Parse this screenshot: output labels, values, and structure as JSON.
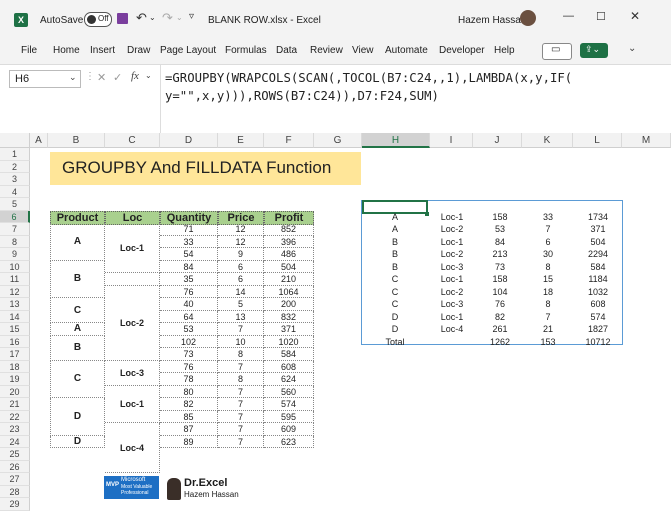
{
  "titlebar": {
    "autosave_label": "AutoSave",
    "autosave_state": "Off",
    "filename": "BLANK ROW.xlsx - Excel",
    "user_name": "Hazem Hassan"
  },
  "menu": [
    "File",
    "Home",
    "Insert",
    "Draw",
    "Page Layout",
    "Formulas",
    "Data",
    "Review",
    "View",
    "Automate",
    "Developer",
    "Help"
  ],
  "namebox": "H6",
  "formula_line1": "=GROUPBY(WRAPCOLS(SCAN(,TOCOL(B7:C24,,1),LAMBDA(x,y,IF(",
  "formula_line2": "y=\"\",x,y))),ROWS(B7:C24)),D7:F24,SUM)",
  "columns": [
    "A",
    "B",
    "C",
    "D",
    "E",
    "F",
    "G",
    "H",
    "I",
    "J",
    "K",
    "L",
    "M"
  ],
  "rows": [
    "1",
    "2",
    "3",
    "4",
    "5",
    "6",
    "7",
    "8",
    "9",
    "10",
    "11",
    "12",
    "13",
    "14",
    "15",
    "16",
    "17",
    "18",
    "19",
    "20",
    "21",
    "22",
    "23",
    "24",
    "25",
    "26",
    "27",
    "28",
    "29"
  ],
  "banner_title": "GROUPBY And FILLDATA Function",
  "table_headers": [
    "Product",
    "Loc",
    "Quantity",
    "Price",
    "Profit"
  ],
  "products": [
    {
      "label": "A",
      "span": 3
    },
    {
      "label": "B",
      "span": 3
    },
    {
      "label": "C",
      "span": 2
    },
    {
      "label": "A",
      "span": 1
    },
    {
      "label": "B",
      "span": 2
    },
    {
      "label": "C",
      "span": 3
    },
    {
      "label": "D",
      "span": 3
    },
    {
      "label": "D",
      "span": 1
    }
  ],
  "locs": [
    {
      "label": "Loc-1",
      "span": 4
    },
    {
      "label": "",
      "span": 1
    },
    {
      "label": "Loc-2",
      "span": 6
    },
    {
      "label": "Loc-3",
      "span": 2
    },
    {
      "label": "Loc-1",
      "span": 3
    },
    {
      "label": "Loc-4",
      "span": 4
    }
  ],
  "quantities": [
    "71",
    "33",
    "54",
    "84",
    "35",
    "76",
    "40",
    "64",
    "53",
    "102",
    "73",
    "76",
    "78",
    "80",
    "82",
    "85",
    "87",
    "89"
  ],
  "prices": [
    "12",
    "12",
    "9",
    "6",
    "6",
    "14",
    "5",
    "13",
    "7",
    "10",
    "8",
    "7",
    "8",
    "7",
    "7",
    "7",
    "7",
    "7"
  ],
  "profits": [
    "852",
    "396",
    "486",
    "504",
    "210",
    "1064",
    "200",
    "832",
    "371",
    "1020",
    "584",
    "608",
    "624",
    "560",
    "574",
    "595",
    "609",
    "623"
  ],
  "result": [
    [
      "A",
      "Loc-1",
      "158",
      "33",
      "1734"
    ],
    [
      "A",
      "Loc-2",
      "53",
      "7",
      "371"
    ],
    [
      "B",
      "Loc-1",
      "84",
      "6",
      "504"
    ],
    [
      "B",
      "Loc-2",
      "213",
      "30",
      "2294"
    ],
    [
      "B",
      "Loc-3",
      "73",
      "8",
      "584"
    ],
    [
      "C",
      "Loc-1",
      "158",
      "15",
      "1184"
    ],
    [
      "C",
      "Loc-2",
      "104",
      "18",
      "1032"
    ],
    [
      "C",
      "Loc-3",
      "76",
      "8",
      "608"
    ],
    [
      "D",
      "Loc-1",
      "82",
      "7",
      "574"
    ],
    [
      "D",
      "Loc-4",
      "261",
      "21",
      "1827"
    ],
    [
      "Total",
      "",
      "1262",
      "153",
      "10712"
    ]
  ],
  "logo": {
    "mvp_line1": "Microsoft",
    "mvp_line2": "Most Valuable",
    "mvp_line3": "Professional",
    "mvp_badge": "MVP",
    "brand": "Dr.Excel",
    "brand_sub": "Hazem Hassan"
  },
  "colors": {
    "excel_green": "#1e7145",
    "header_green": "#a9d08e",
    "banner_yellow": "#ffe699",
    "selection": "#217346"
  }
}
